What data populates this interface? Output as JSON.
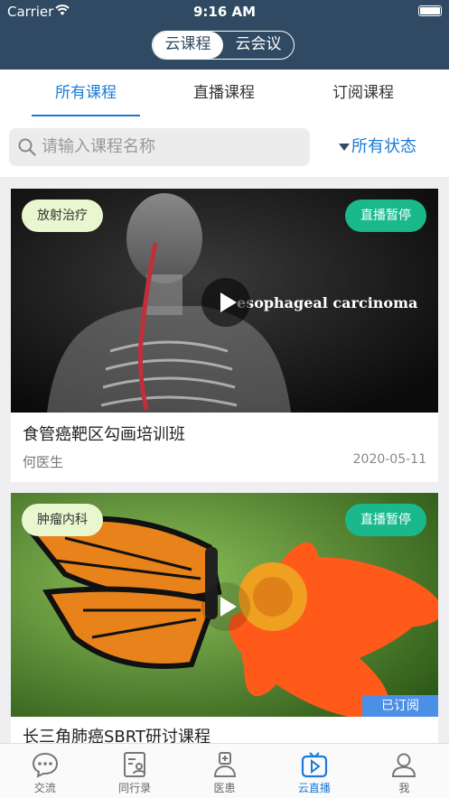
{
  "status_bar": {
    "carrier": "Carrier",
    "time": "9:16 AM"
  },
  "header": {
    "segments": [
      {
        "label": "云课程",
        "active": true
      },
      {
        "label": "云会议",
        "active": false
      }
    ]
  },
  "tabs": [
    {
      "label": "所有课程",
      "active": true
    },
    {
      "label": "直播课程",
      "active": false
    },
    {
      "label": "订阅课程",
      "active": false
    }
  ],
  "search": {
    "placeholder": "请输入课程名称",
    "icon": "search-icon"
  },
  "filter": {
    "label": "所有状态"
  },
  "courses": [
    {
      "category": "放射治疗",
      "live_status": "直播暂停",
      "overlay_text": "esophageal carcinoma",
      "title": "食管癌靶区勾画培训班",
      "author": "何医生",
      "date": "2020-05-11",
      "subscribed": false
    },
    {
      "category": "肿瘤内科",
      "live_status": "直播暂停",
      "title": "长三角肺癌SBRT研讨课程",
      "subscribed": true,
      "subscribed_label": "已订阅"
    }
  ],
  "tabbar": [
    {
      "label": "交流",
      "icon": "chat-bubble-icon",
      "active": false
    },
    {
      "label": "同行录",
      "icon": "contacts-card-icon",
      "active": false
    },
    {
      "label": "医患",
      "icon": "doctor-icon",
      "active": false
    },
    {
      "label": "云直播",
      "icon": "tv-play-icon",
      "active": true
    },
    {
      "label": "我",
      "icon": "person-icon",
      "active": false
    }
  ],
  "colors": {
    "header": "#2f4a62",
    "accent": "#1a7bd6",
    "live": "#19b98c",
    "subscribed": "#4c8fe6"
  }
}
